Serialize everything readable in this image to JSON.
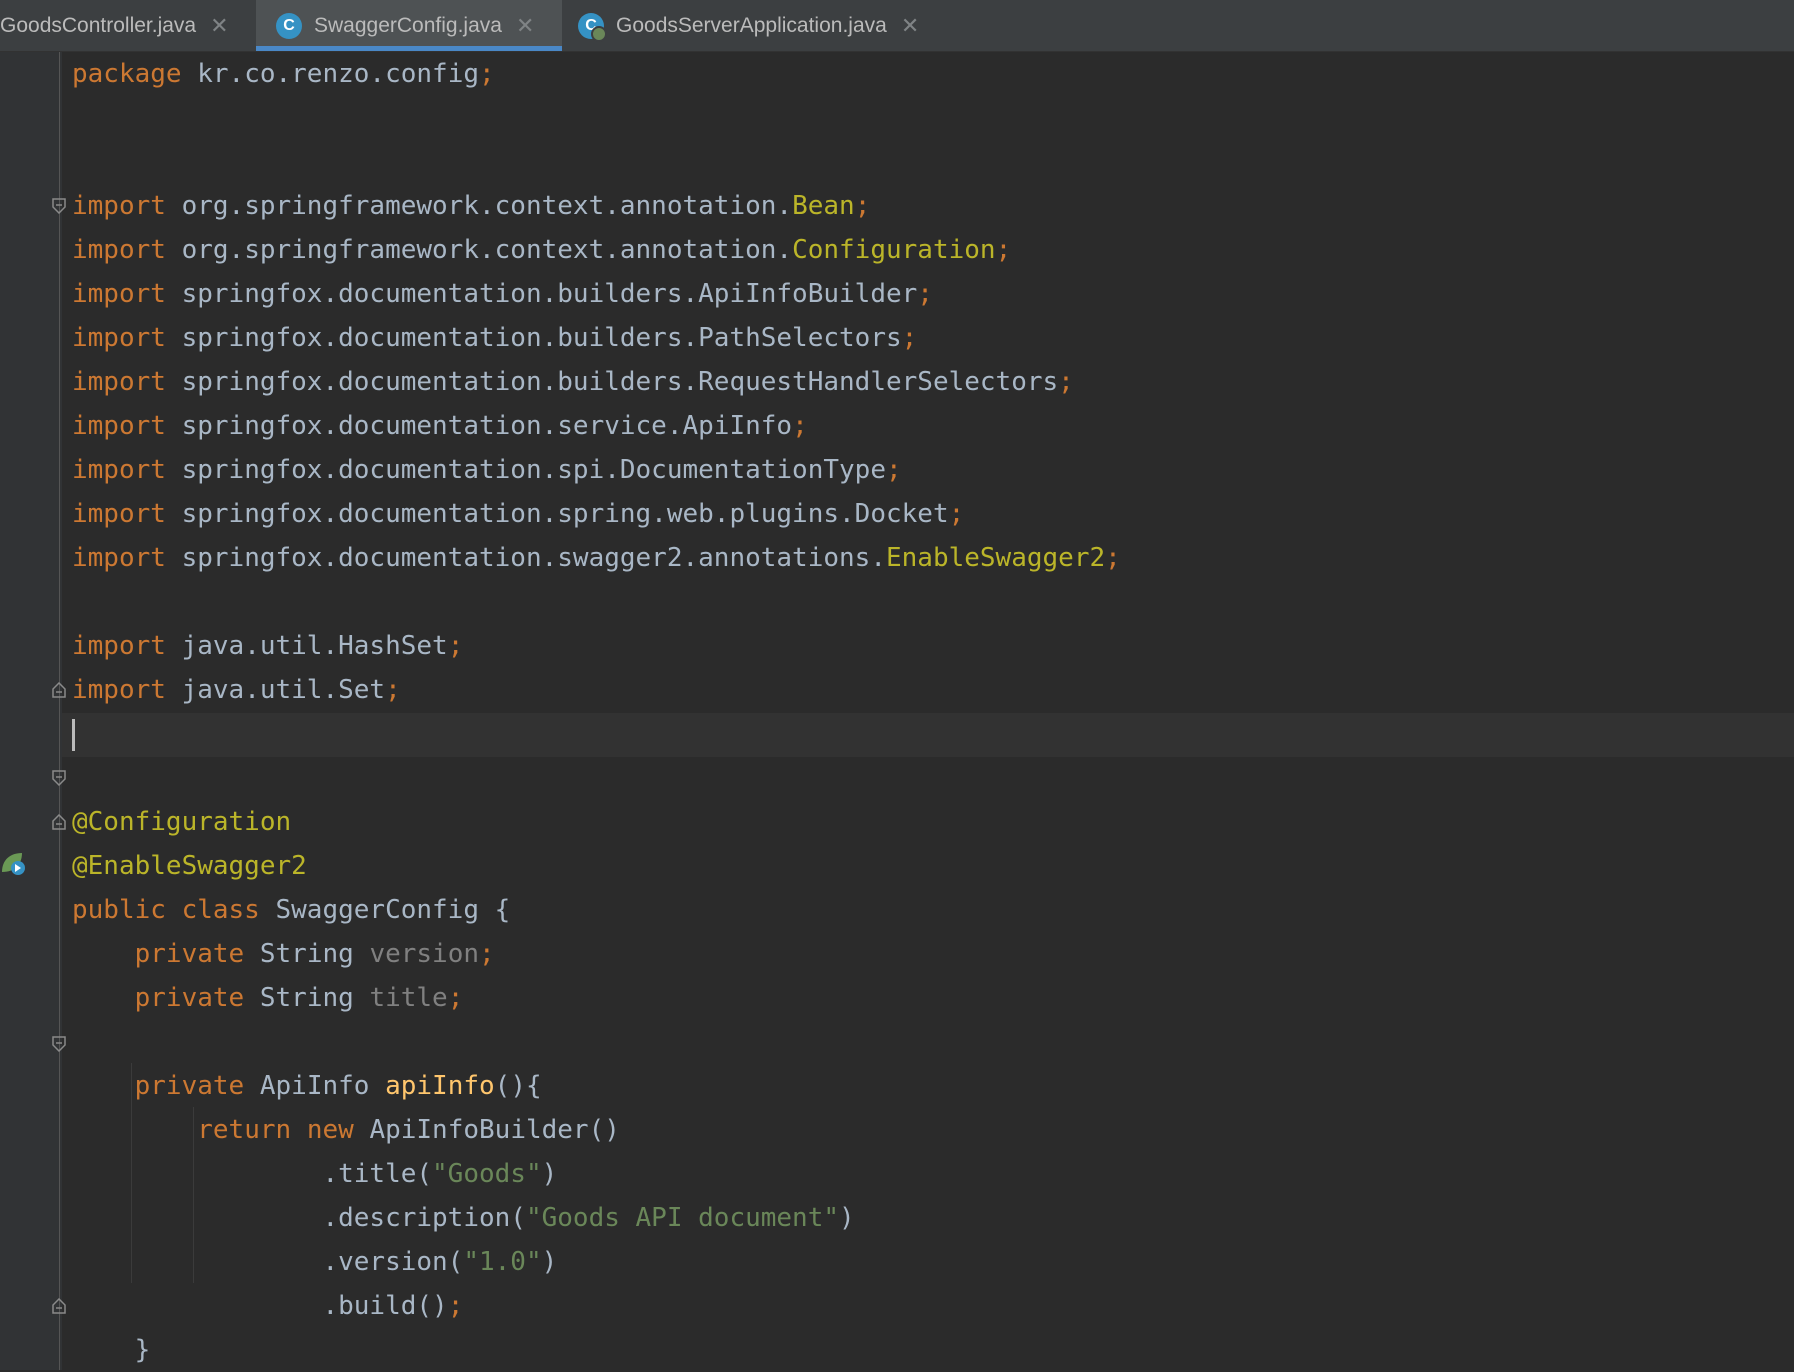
{
  "tabs": [
    {
      "label": "GoodsController.java",
      "icon": "none",
      "active": false
    },
    {
      "label": "SwaggerConfig.java",
      "icon": "class-c-icon",
      "active": true
    },
    {
      "label": "GoodsServerApplication.java",
      "icon": "spring-app-icon",
      "active": false
    }
  ],
  "code": {
    "package_kw": "package",
    "package_name": "kr.co.renzo.config",
    "imports": [
      {
        "kw": "import",
        "path": "org.springframework.context.annotation.",
        "cls": "Bean"
      },
      {
        "kw": "import",
        "path": "org.springframework.context.annotation.",
        "cls": "Configuration"
      },
      {
        "kw": "import",
        "path": "springfox.documentation.builders.ApiInfoBuilder",
        "cls": ""
      },
      {
        "kw": "import",
        "path": "springfox.documentation.builders.PathSelectors",
        "cls": ""
      },
      {
        "kw": "import",
        "path": "springfox.documentation.builders.RequestHandlerSelectors",
        "cls": ""
      },
      {
        "kw": "import",
        "path": "springfox.documentation.service.ApiInfo",
        "cls": ""
      },
      {
        "kw": "import",
        "path": "springfox.documentation.spi.DocumentationType",
        "cls": ""
      },
      {
        "kw": "import",
        "path": "springfox.documentation.spring.web.plugins.Docket",
        "cls": ""
      },
      {
        "kw": "import",
        "path": "springfox.documentation.swagger2.annotations.",
        "cls": "EnableSwagger2"
      },
      {
        "kw": "import",
        "path": "java.util.HashSet",
        "cls": ""
      },
      {
        "kw": "import",
        "path": "java.util.Set",
        "cls": ""
      }
    ],
    "annotation1": "@Configuration",
    "annotation2": "@EnableSwagger2",
    "class_kw": "public class",
    "class_name": "SwaggerConfig",
    "private_kw": "private",
    "string_type": "String",
    "field1": "version",
    "field2": "title",
    "apiinfo_type": "ApiInfo",
    "method_name": "apiInfo",
    "return_kw": "return",
    "new_kw": "new",
    "builder": "ApiInfoBuilder",
    "title_call": ".title(",
    "title_val": "\"Goods\"",
    "desc_call": ".description(",
    "desc_val": "\"Goods API document\"",
    "version_call": ".version(",
    "version_val": "\"1.0\"",
    "build_call": ".build()"
  }
}
